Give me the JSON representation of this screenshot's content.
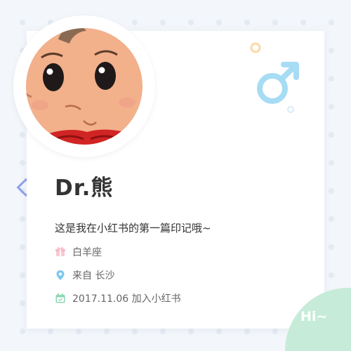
{
  "profile": {
    "name": "Dr.熊",
    "bio": "这是我在小红书的第一篇印记哦~",
    "gender_icon": "male-symbol-icon",
    "avatar_icon": "cartoon-baby-avatar"
  },
  "info": [
    {
      "icon": "gift-icon",
      "text": "白羊座"
    },
    {
      "icon": "location-pin-icon",
      "text": "来自 长沙"
    },
    {
      "icon": "calendar-icon",
      "text": "2017.11.06 加入小红书"
    }
  ],
  "badge": {
    "text": "Hi~"
  },
  "colors": {
    "accent_pink": "#f7b6c3",
    "accent_blue": "#7ec8ec",
    "accent_green": "#8dd6b4",
    "male_blue": "#a6dcf4",
    "badge_green": "#c6ecd9"
  }
}
